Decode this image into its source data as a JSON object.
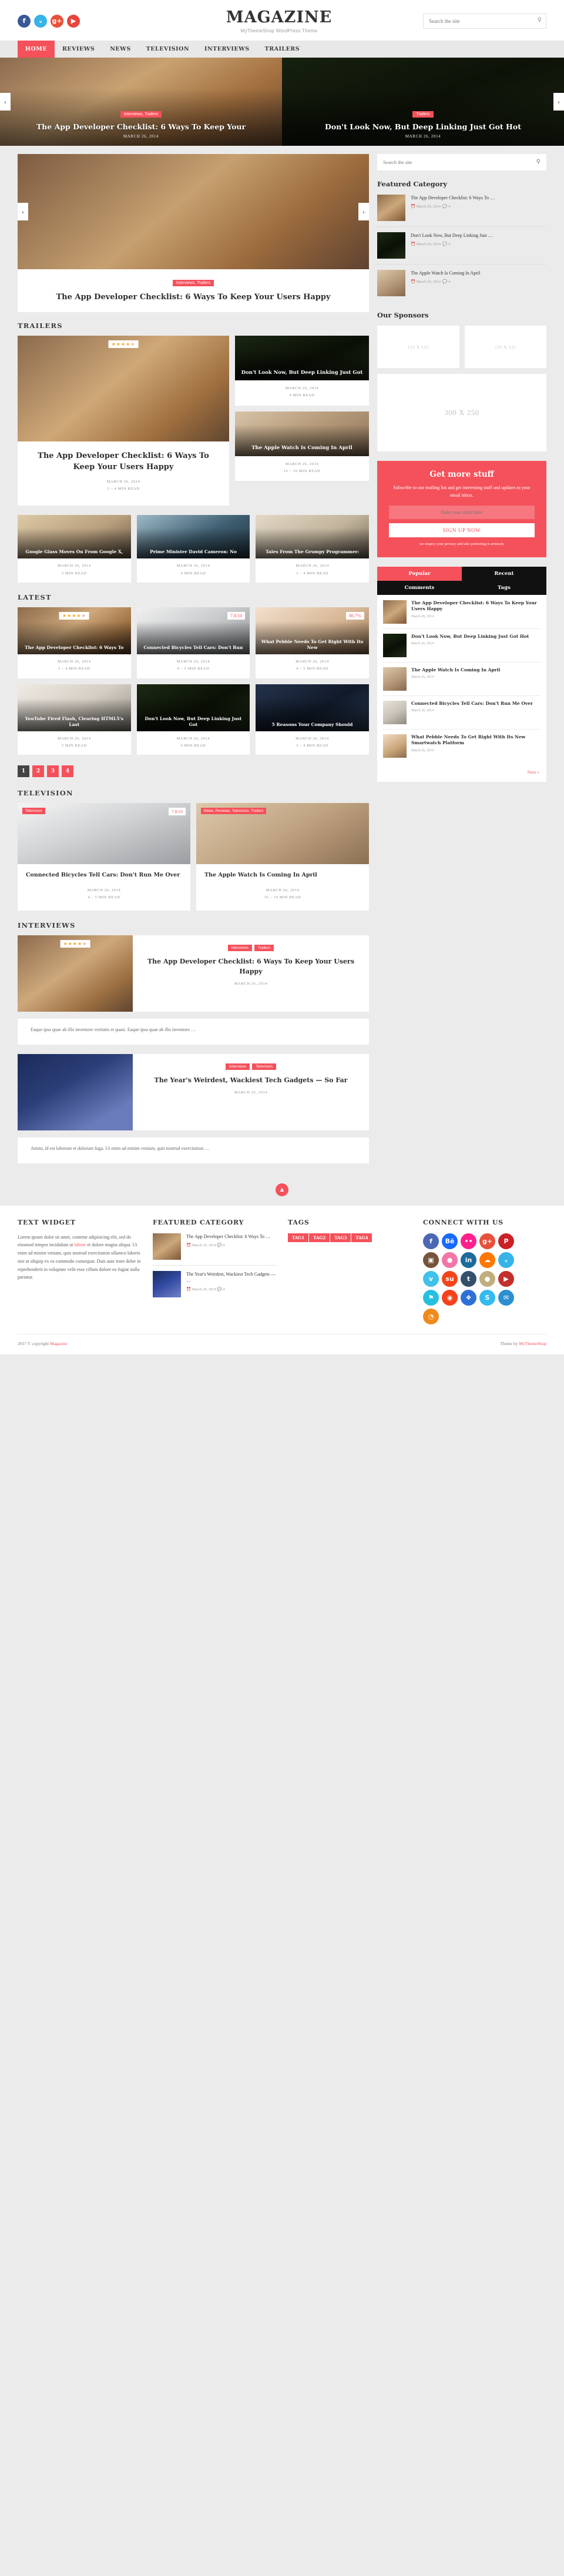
{
  "header": {
    "brand_title": "MAGAZINE",
    "tagline": "MyThemeShop WordPress Theme",
    "search_placeholder": "Search the site",
    "social": [
      {
        "name": "facebook",
        "glyph": "f",
        "color": "#3b5998"
      },
      {
        "name": "twitter",
        "glyph": "ᵥ",
        "color": "#36b4e8"
      },
      {
        "name": "google-plus",
        "glyph": "g+",
        "color": "#e8503a"
      },
      {
        "name": "youtube",
        "glyph": "▶",
        "color": "#e8453c"
      }
    ]
  },
  "nav": [
    {
      "label": "HOME",
      "active": true
    },
    {
      "label": "REVIEWS",
      "active": false
    },
    {
      "label": "NEWS",
      "active": false
    },
    {
      "label": "TELEVISION",
      "active": false
    },
    {
      "label": "INTERVIEWS",
      "active": false
    },
    {
      "label": "TRAILERS",
      "active": false
    }
  ],
  "top_slider": {
    "prev": "‹",
    "next": "›",
    "slides": [
      {
        "category": "Interviews, Trailers",
        "title": "The App Developer Checklist: 6 Ways To Keep Your",
        "date": "MARCH 26, 2014"
      },
      {
        "category": "Trailers",
        "title": "Don't Look Now, But Deep Linking Just Got Hot",
        "date": "MARCH 26, 2014"
      }
    ]
  },
  "hero": {
    "category": "Interviews, Trailers",
    "title": "The App Developer Checklist: 6 Ways To Keep Your Users Happy",
    "stars": "★★★★",
    "star_last": "★",
    "prev": "‹",
    "next": "›"
  },
  "trailers": {
    "heading": "TRAILERS",
    "featured": {
      "title": "The App Developer Checklist: 6 Ways To Keep Your Users Happy",
      "date": "MARCH 26, 2014",
      "read": "3 – 4 MIN READ",
      "stars": "★★★★",
      "star_last": "★"
    },
    "side": [
      {
        "title": "Don't Look Now, But Deep Linking Just Got",
        "date": "MARCH 26, 2014",
        "read": "4 MIN READ",
        "img": "kb"
      },
      {
        "title": "The Apple Watch Is Coming In April",
        "date": "MARCH 26, 2014",
        "read": "16 – 19 MIN READ",
        "img": "wt"
      }
    ],
    "row3": [
      {
        "title": "Google Glass Moves On From Google X,",
        "date": "MARCH 26, 2014",
        "read": "5 MIN READ",
        "img": "g1"
      },
      {
        "title": "Prime Minister David Cameron: No",
        "date": "MARCH 26, 2014",
        "read": "4 MIN READ",
        "img": "g2"
      },
      {
        "title": "Tales From The Grumpy Programmer:",
        "date": "MARCH 26, 2014",
        "read": "3 – 4 MIN READ",
        "img": "g3"
      }
    ]
  },
  "latest": {
    "heading": "LATEST",
    "cards": [
      {
        "title": "The App Developer Checklist: 6 Ways To",
        "date": "MARCH 26, 2014",
        "read": "3 – 4 MIN READ",
        "img": "p1",
        "badge": "stars",
        "stars": "★★★★",
        "star_last": "★"
      },
      {
        "title": "Connected Bicycles Tell Cars: Don't Run",
        "date": "MARCH 26, 2014",
        "read": "4 – 5 MIN READ",
        "img": "p2",
        "badge": "score",
        "score": "7.8/10"
      },
      {
        "title": "What Pebble Needs To Get Right With Its New",
        "date": "MARCH 26, 2014",
        "read": "4 – 5 MIN READ",
        "img": "p3",
        "badge": "score",
        "score": "86.7%"
      },
      {
        "title": "YouTube Fired Flash, Clearing HTML5's Last",
        "date": "MARCH 26, 2014",
        "read": "5 MIN READ",
        "img": "p4",
        "badge": "none"
      },
      {
        "title": "Don't Look Now, But Deep Linking Just Got",
        "date": "MARCH 26, 2014",
        "read": "4 MIN READ",
        "img": "p5",
        "badge": "none"
      },
      {
        "title": "5 Reasons Your Company Should",
        "date": "MARCH 26, 2014",
        "read": "3 – 4 MIN READ",
        "img": "p6",
        "badge": "none"
      }
    ],
    "pages": [
      {
        "n": "1",
        "current": true
      },
      {
        "n": "2",
        "current": false
      },
      {
        "n": "3",
        "current": false
      },
      {
        "n": "4",
        "current": false
      }
    ]
  },
  "television": {
    "heading": "TELEVISION",
    "cards": [
      {
        "category": "Television",
        "score": "7.8/10",
        "title": "Connected Bicycles Tell Cars: Don't Run Me Over",
        "date": "MARCH 26, 2014",
        "read": "4 – 5 MIN READ",
        "img": "a"
      },
      {
        "category": "News, Reviews, Television, Trailers",
        "score": "",
        "title": "The Apple Watch Is Coming In April",
        "date": "MARCH 26, 2014",
        "read": "16 – 19 MIN READ",
        "img": "b"
      }
    ]
  },
  "interviews": {
    "heading": "INTERVIEWS",
    "items": [
      {
        "categories": [
          "Interviews",
          "Trailers"
        ],
        "title": "The App Developer Checklist: 6 Ways To Keep Your Users Happy",
        "date": "MARCH 26, 2014",
        "excerpt": "Eaque ipsa quae ab illo inventore veritatis et quasi. Eaque ipsa quae ab illo inventore …",
        "img": "a",
        "stars": "★★★★",
        "star_last": "★"
      },
      {
        "categories": [
          "Interviews",
          "Television"
        ],
        "title": "The Year's Weirdest, Wackiest Tech Gadgets — So Far",
        "date": "MARCH 26, 2014",
        "excerpt": "Animi, id est laborum et dolorum fuga. Ut enim ad minim veniam, quis nostrud exercitation …",
        "img": "b",
        "stars": "",
        "star_last": ""
      }
    ]
  },
  "sidebar": {
    "search_placeholder": "Search the site",
    "featured_category": {
      "title": "Featured Category",
      "items": [
        {
          "title": "The App Developer Checklist: 6 Ways To …",
          "date": "March 26, 2014",
          "comments": "4",
          "thumb": "a"
        },
        {
          "title": "Don't Look Now, But Deep Linking Just …",
          "date": "March 26, 2014",
          "comments": "4",
          "thumb": "b"
        },
        {
          "title": "The Apple Watch Is Coming In April",
          "date": "March 26, 2014",
          "comments": "4",
          "thumb": "c"
        }
      ]
    },
    "sponsors": {
      "title": "Our Sponsors",
      "small": [
        "125 X 125",
        "125 X 125"
      ],
      "large": "300 X 250"
    },
    "newsletter": {
      "title": "Get more stuff",
      "desc": "Subscribe to our mailing list and get interesting stuff and updates to your email inbox.",
      "placeholder": "Enter your email here",
      "button": "SIGN UP NOW",
      "note": "we respect your privacy and take protecting it seriously"
    },
    "tabs": {
      "labels": [
        {
          "label": "Popular",
          "on": true
        },
        {
          "label": "Recent",
          "on": false
        },
        {
          "label": "Comments",
          "on": false
        },
        {
          "label": "Tags",
          "on": false
        }
      ],
      "posts": [
        {
          "title": "The App Developer Checklist: 6 Ways To Keep Your Users Happy",
          "date": "March 26, 2014",
          "thumb": "a"
        },
        {
          "title": "Don't Look Now, But Deep Linking Just Got Hot",
          "date": "March 26, 2014",
          "thumb": "b"
        },
        {
          "title": "The Apple Watch Is Coming In April",
          "date": "March 26, 2014",
          "thumb": "c"
        },
        {
          "title": "Connected Bicycles Tell Cars: Don't Run Me Over",
          "date": "March 26, 2014",
          "thumb": "d"
        },
        {
          "title": "What Pebble Needs To Get Right With Its New Smartwatch Platform",
          "date": "March 26, 2014",
          "thumb": "e"
        }
      ],
      "next": "Next »"
    }
  },
  "footer": {
    "back_to_top": "▲",
    "text_widget": {
      "heading": "TEXT WIDGET",
      "before": "Lorem ipsum dolor sit amet, contetur adipisicing elit, sed do eiusmod tempor incididunt ut ",
      "link": "labore",
      "after": " et dolore magna aliqua. Ut enim ad minim veniam, quis nostrud exercitation ullamco laboris nisi ut aliquip ex ea commodo consequat. Duis aute irure dolor in reprehenderit in voluptate velit esse cillum dolore eu fugiat nulla pariatur."
    },
    "featured_category": {
      "heading": "FEATURED CATEGORY",
      "items": [
        {
          "title": "The App Developer Checklist: 6 Ways To …",
          "date": "March 26, 2014",
          "comments": "4",
          "thumb": "a"
        },
        {
          "title": "The Year's Weirdest, Wackiest Tech Gadgets — …",
          "date": "March 26, 2014",
          "comments": "4",
          "thumb": "f"
        }
      ]
    },
    "tags": {
      "heading": "TAGS",
      "items": [
        "TAG1",
        "TAG2",
        "TAG3",
        "TAG4"
      ]
    },
    "connect": {
      "heading": "CONNECT WITH US",
      "icons": [
        {
          "name": "facebook",
          "glyph": "f",
          "color": "#4a68b3"
        },
        {
          "name": "behance",
          "glyph": "Bē",
          "color": "#1769ff"
        },
        {
          "name": "flickr",
          "glyph": "••",
          "color": "#ff1f8d"
        },
        {
          "name": "google-plus",
          "glyph": "g+",
          "color": "#e8503a"
        },
        {
          "name": "pinterest",
          "glyph": "P",
          "color": "#cb2027"
        },
        {
          "name": "instagram",
          "glyph": "▣",
          "color": "#77553b"
        },
        {
          "name": "dribbble",
          "glyph": "●",
          "color": "#f276a8"
        },
        {
          "name": "linkedin",
          "glyph": "in",
          "color": "#1c6b9c"
        },
        {
          "name": "soundcloud",
          "glyph": "☁",
          "color": "#ff7700"
        },
        {
          "name": "twitter",
          "glyph": "ᵥ",
          "color": "#36b4e8"
        },
        {
          "name": "vimeo",
          "glyph": "v",
          "color": "#3fc1ea"
        },
        {
          "name": "stumbleupon",
          "glyph": "su",
          "color": "#f44419"
        },
        {
          "name": "tumblr",
          "glyph": "t",
          "color": "#35506b"
        },
        {
          "name": "github",
          "glyph": "●",
          "color": "#bfae7e"
        },
        {
          "name": "youtube",
          "glyph": "▶",
          "color": "#c4302b"
        },
        {
          "name": "foursquare",
          "glyph": "⚑",
          "color": "#25c0e0"
        },
        {
          "name": "reddit",
          "glyph": "◉",
          "color": "#f4411d"
        },
        {
          "name": "dropbox",
          "glyph": "❖",
          "color": "#2e6fd9"
        },
        {
          "name": "skype",
          "glyph": "S",
          "color": "#33bbf0"
        },
        {
          "name": "email",
          "glyph": "✉",
          "color": "#2b8fd0"
        },
        {
          "name": "rss",
          "glyph": "◔",
          "color": "#f08a1c"
        }
      ]
    },
    "copyright_prefix": "2017 © copyright ",
    "copyright_link": "Magazine",
    "theme_prefix": "Theme by ",
    "theme_link": "MyThemeShop"
  }
}
